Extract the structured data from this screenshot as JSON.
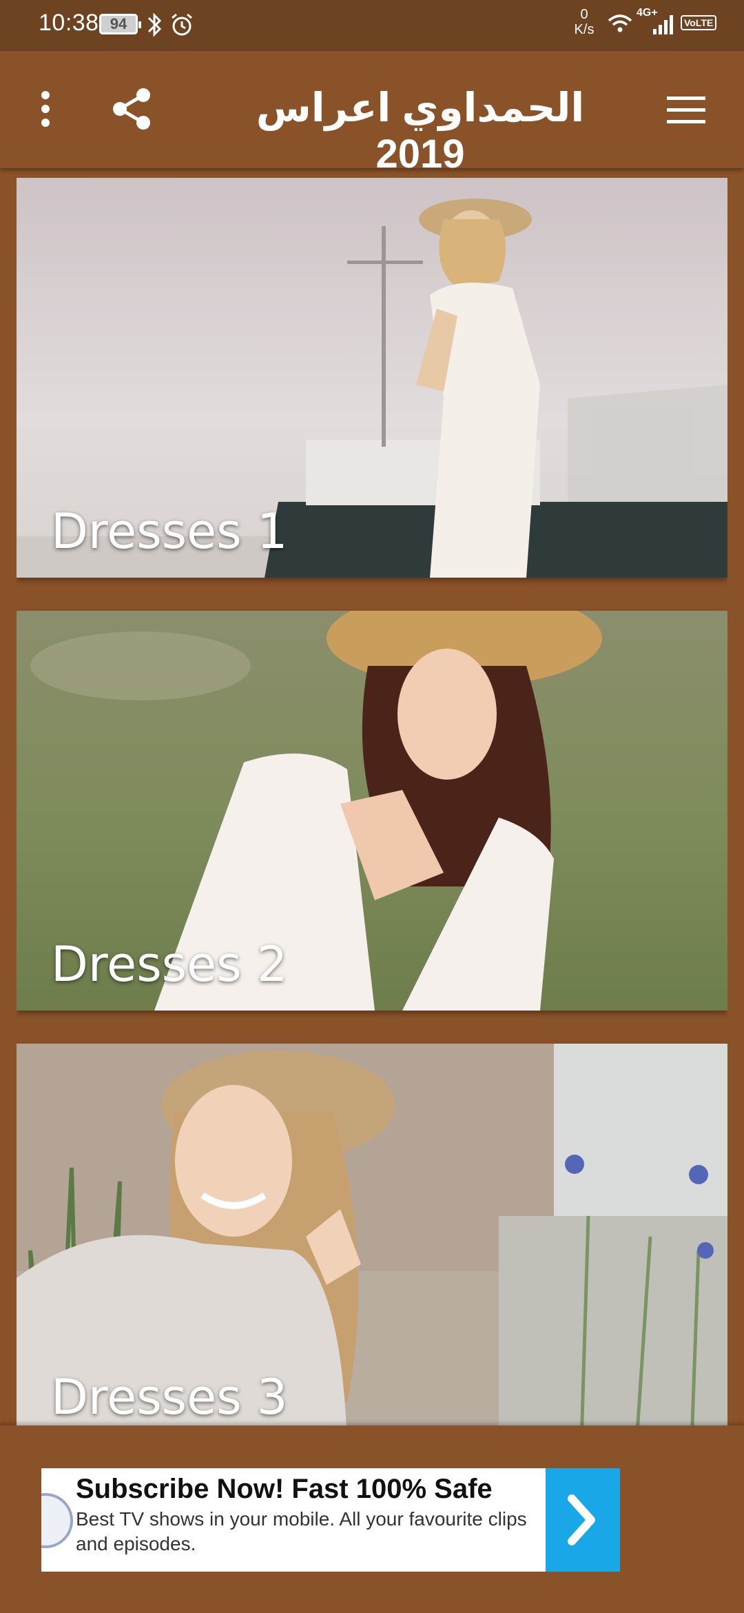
{
  "status_bar": {
    "time": "10:38",
    "battery": "94",
    "net_speed_value": "0",
    "net_speed_unit": "K/s",
    "network_type": "4G+",
    "volte": "VoLTE"
  },
  "app_bar": {
    "title": "الحمداوي اعراس 2019"
  },
  "cards": [
    {
      "title": "Dresses 1"
    },
    {
      "title": "Dresses 2"
    },
    {
      "title": "Dresses 3"
    }
  ],
  "ad": {
    "headline": "Subscribe Now! Fast 100% Safe",
    "body": "Best TV shows in your mobile. All your favourite clips and episodes."
  },
  "colors": {
    "primary": "#8a5228",
    "status_bar": "#6e4322",
    "ad_accent": "#1aa7e8"
  },
  "icons": {
    "menu": "hamburger-menu-icon",
    "share": "share-icon",
    "overflow": "more-vert-icon",
    "ad_arrow": "chevron-right-icon"
  }
}
